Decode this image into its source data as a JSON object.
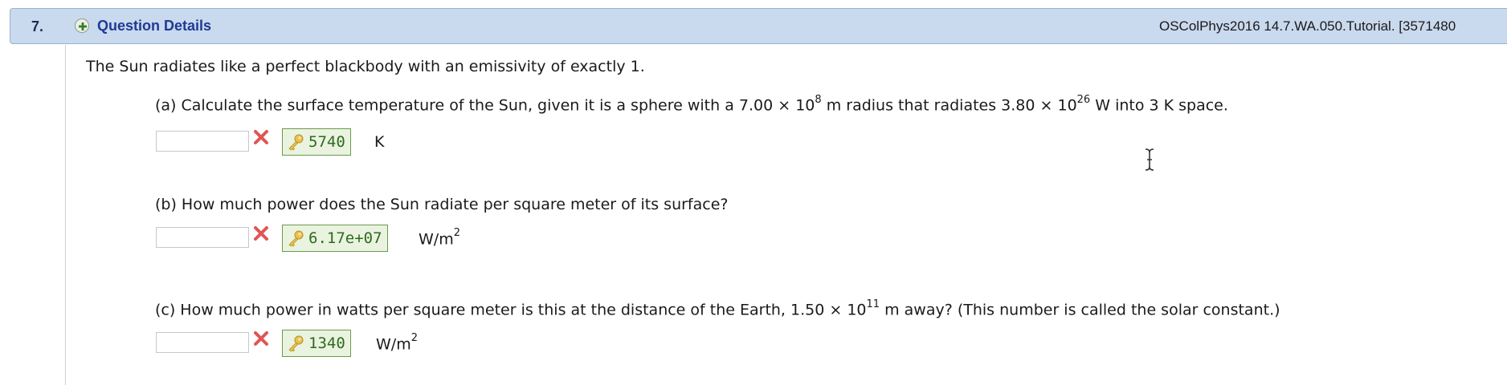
{
  "header": {
    "question_number": "7.",
    "details_label": "Question Details",
    "reference": "OSColPhys2016 14.7.WA.050.Tutorial. [3571480"
  },
  "intro": "The Sun radiates like a perfect blackbody with an emissivity of exactly 1.",
  "parts": [
    {
      "question_pre": "(a) Calculate the surface temperature of the Sun, given it is a sphere with a 7.00 × 10",
      "exp1": "8",
      "question_mid": " m radius that radiates 3.80 × 10",
      "exp2": "26",
      "question_post": " W into 3 K space.",
      "input_value": "",
      "key_value": "5740",
      "unit": "K",
      "status": "incorrect"
    },
    {
      "question": "(b) How much power does the Sun radiate per square meter of its surface?",
      "input_value": "",
      "key_value": "6.17e+07",
      "unit_base": "W/m",
      "unit_exp": "2",
      "status": "incorrect"
    },
    {
      "question_pre": "(c) How much power in watts per square meter is this at the distance of the Earth, 1.50 × 10",
      "exp1": "11",
      "question_post": " m away? (This number is called the solar constant.)",
      "input_value": "",
      "key_value": "1340",
      "unit_base": "W/m",
      "unit_exp": "2",
      "status": "incorrect"
    }
  ],
  "icons": {
    "expand": "plus-circle-icon",
    "wrong": "red-x-icon",
    "key": "key-icon",
    "cursor": "text-cursor-icon"
  },
  "colors": {
    "header_bg": "#c9d9ee",
    "link": "#1f3a93",
    "wrong": "#e05555",
    "key_green": "#2e6b1e",
    "key_bg": "#eaf3e0"
  }
}
